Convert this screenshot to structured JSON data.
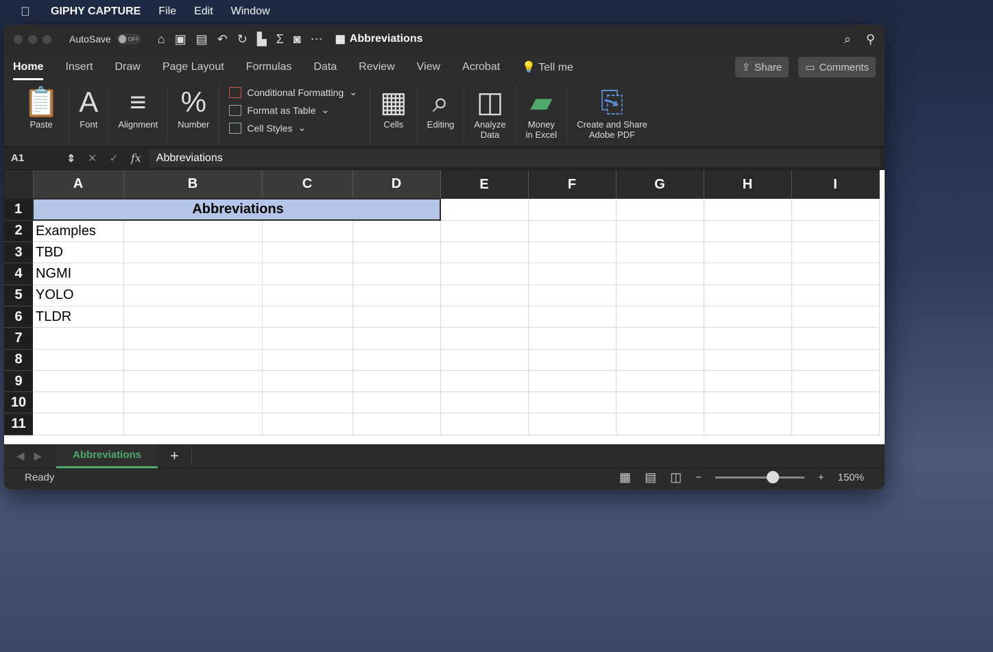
{
  "menubar": {
    "apple": "",
    "app_name": "GIPHY CAPTURE",
    "items": [
      "File",
      "Edit",
      "Window"
    ]
  },
  "titlebar": {
    "autosave_label": "AutoSave",
    "autosave_state": "OFF",
    "document_title": "Abbreviations"
  },
  "ribbon_tabs": [
    "Home",
    "Insert",
    "Draw",
    "Page Layout",
    "Formulas",
    "Data",
    "Review",
    "View",
    "Acrobat",
    "Tell me"
  ],
  "actions": {
    "share": "Share",
    "comments": "Comments"
  },
  "ribbon": {
    "paste": "Paste",
    "font": "Font",
    "alignment": "Alignment",
    "number": "Number",
    "conditional_formatting": "Conditional Formatting",
    "format_as_table": "Format as Table",
    "cell_styles": "Cell Styles",
    "cells": "Cells",
    "editing": "Editing",
    "analyze_data_1": "Analyze",
    "analyze_data_2": "Data",
    "money_1": "Money",
    "money_2": "in Excel",
    "pdf_1": "Create and Share",
    "pdf_2": "Adobe PDF"
  },
  "formula_bar": {
    "name_box": "A1",
    "fx": "fx",
    "value": "Abbreviations"
  },
  "columns": [
    "A",
    "B",
    "C",
    "D",
    "E",
    "F",
    "G",
    "H",
    "I"
  ],
  "rows": [
    {
      "n": "1",
      "a": "Abbreviations"
    },
    {
      "n": "2",
      "a": "Examples"
    },
    {
      "n": "3",
      "a": "TBD"
    },
    {
      "n": "4",
      "a": "NGMI"
    },
    {
      "n": "5",
      "a": "YOLO"
    },
    {
      "n": "6",
      "a": "TLDR"
    },
    {
      "n": "7",
      "a": ""
    },
    {
      "n": "8",
      "a": ""
    },
    {
      "n": "9",
      "a": ""
    },
    {
      "n": "10",
      "a": ""
    },
    {
      "n": "11",
      "a": ""
    }
  ],
  "sheet": {
    "tab": "Abbreviations",
    "add": "+"
  },
  "status": {
    "ready": "Ready",
    "zoom": "150%",
    "zoom_level": 0.65
  }
}
